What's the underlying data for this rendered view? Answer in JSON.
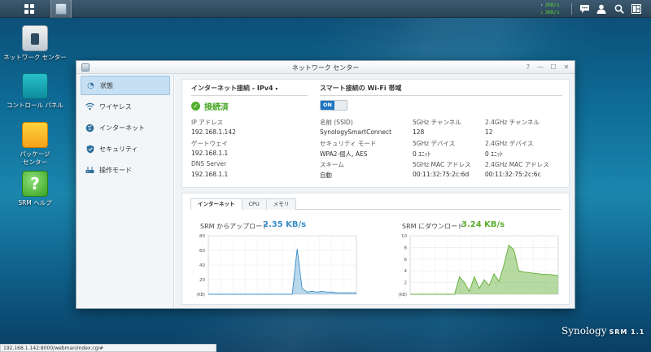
{
  "taskbar": {
    "upload_speed": "2KB/s",
    "download_speed": "3KB/s"
  },
  "desktop": {
    "icons": [
      {
        "label": "ネットワーク センター"
      },
      {
        "label": "コントロール パネル"
      },
      {
        "label": "パッケージ\nセンター"
      },
      {
        "label": "SRM ヘルプ"
      }
    ]
  },
  "window": {
    "title": "ネットワーク センター",
    "controls": [
      "?",
      "—",
      "☐",
      "✕"
    ],
    "sidebar": [
      {
        "label": "状態",
        "icon": "dashboard-icon"
      },
      {
        "label": "ワイヤレス",
        "icon": "wifi-icon"
      },
      {
        "label": "インターネット",
        "icon": "globe-icon"
      },
      {
        "label": "セキュリティ",
        "icon": "shield-icon"
      },
      {
        "label": "操作モード",
        "icon": "router-icon"
      }
    ],
    "internet": {
      "heading": "インターネット接続 - IPv4",
      "status": "接続済",
      "ip_label": "IP アドレス",
      "ip_value": "192.168.1.142",
      "gateway_label": "ゲートウェイ",
      "gateway_value": "192.168.1.1",
      "dns_label": "DNS Server",
      "dns_value": "192.168.1.1"
    },
    "wifi": {
      "heading": "スマート接続の Wi-Fi 帯域",
      "toggle": "ON",
      "ssid_label": "名前 (SSID)",
      "ssid_value": "SynologySmartConnect",
      "sec_label": "セキュリティ モード",
      "sec_value": "WPA2-個人, AES",
      "scheme_label": "スキーム",
      "scheme_value": "自動",
      "ch5_label": "5GHz チャンネル",
      "ch5_value": "128",
      "dev5_label": "5GHz デバイス",
      "dev5_value": "0 ﾕﾆｯﾄ",
      "mac5_label": "5GHz MAC アドレス",
      "mac5_value": "00:11:32:75:2c:6d",
      "ch24_label": "2.4GHz チャンネル",
      "ch24_value": "12",
      "dev24_label": "2.4GHz デバイス",
      "dev24_value": "0 ﾕﾆｯﾄ",
      "mac24_label": "2.4GHz MAC アドレス",
      "mac24_value": "00:11:32:75:2c:6c"
    },
    "tabs": [
      "インターネット",
      "CPU",
      "メモリ"
    ],
    "upload_title": "SRM からアップロード",
    "upload_value": "2.35 KB/s",
    "download_title": "SRM にダウンロード",
    "download_value": "3.24 KB/s"
  },
  "statusbar": {
    "url": "192.168.1.142:8000/webman/index.cgi#"
  },
  "brand": {
    "name": "Synology",
    "product": "SRM 1.1"
  },
  "colors": {
    "upload": "#3a8ec8",
    "download": "#5fae32"
  },
  "chart_data": [
    {
      "type": "area",
      "title": "SRM からアップロード",
      "ylabel": "(KB)",
      "ylim": [
        0,
        80
      ],
      "yticks": [
        0,
        20,
        40,
        60,
        80
      ],
      "x": [
        0,
        1,
        2,
        3,
        4,
        5,
        6,
        7,
        8,
        9,
        10,
        11,
        12,
        13,
        14,
        15,
        16,
        17,
        18,
        19,
        20,
        21,
        22,
        23,
        24,
        25,
        26,
        27,
        28,
        29,
        30
      ],
      "values": [
        0,
        0,
        0,
        0,
        0,
        0,
        0,
        0,
        0,
        0,
        0,
        0,
        0,
        0,
        0,
        0,
        0,
        0,
        62,
        8,
        3,
        4,
        3,
        4,
        3,
        3,
        2,
        2,
        2,
        2,
        2
      ]
    },
    {
      "type": "area",
      "title": "SRM にダウンロード",
      "ylabel": "(KB)",
      "ylim": [
        0,
        10
      ],
      "yticks": [
        0,
        2,
        4,
        6,
        8,
        10
      ],
      "x": [
        0,
        1,
        2,
        3,
        4,
        5,
        6,
        7,
        8,
        9,
        10,
        11,
        12,
        13,
        14,
        15,
        16,
        17,
        18,
        19,
        20,
        21,
        22,
        23,
        24,
        25,
        26,
        27,
        28,
        29,
        30
      ],
      "values": [
        0,
        0,
        0,
        0,
        0,
        0,
        0,
        0,
        0,
        0,
        3,
        2,
        0.5,
        3,
        1,
        2.5,
        1.5,
        3.5,
        2.2,
        5,
        8.4,
        7.6,
        4,
        3.8,
        3.7,
        3.6,
        3.5,
        3.4,
        3.4,
        3.3,
        3.2
      ]
    }
  ]
}
